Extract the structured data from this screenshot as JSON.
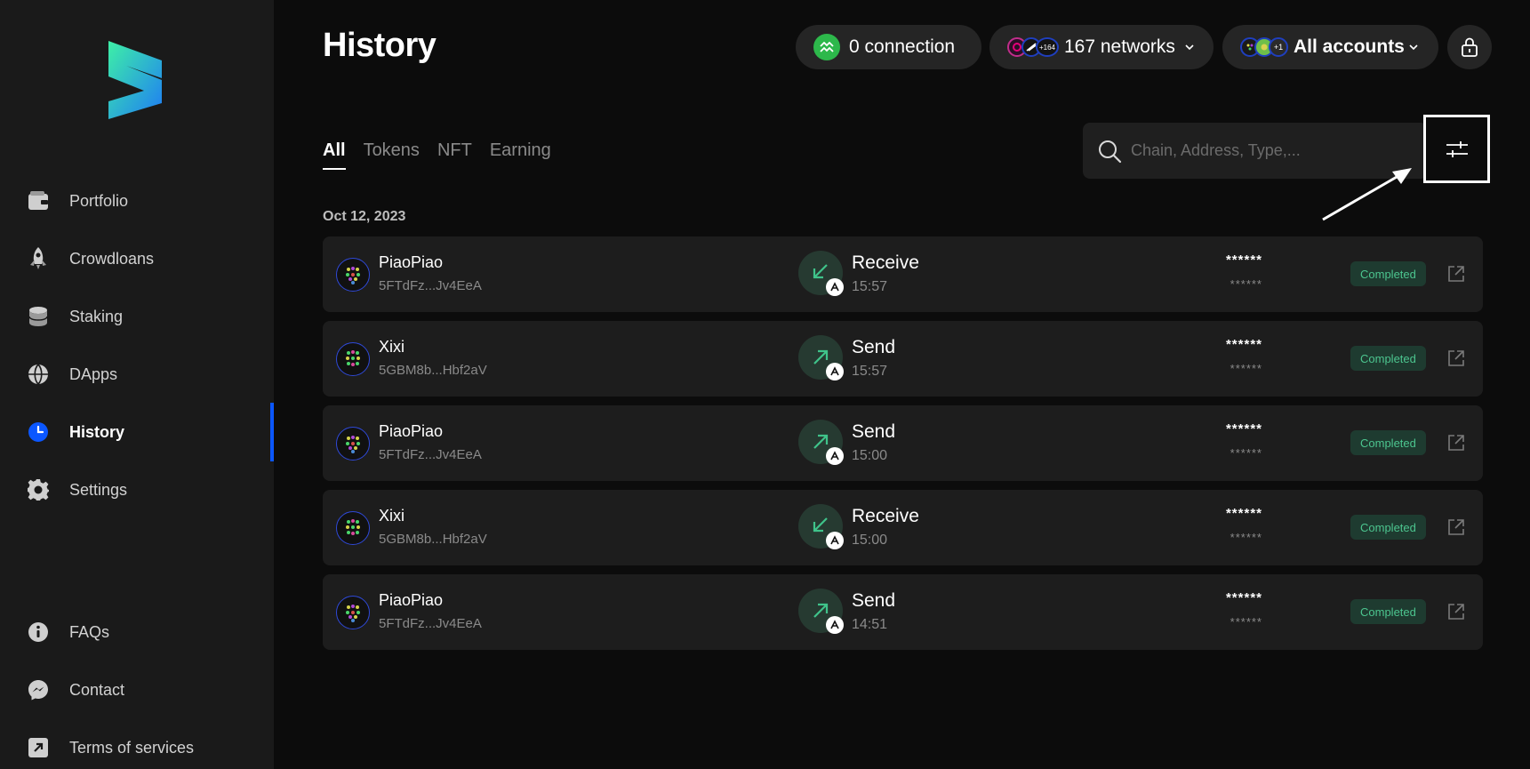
{
  "sidebar": {
    "nav": [
      {
        "key": "portfolio",
        "label": "Portfolio",
        "icon": "wallet-icon"
      },
      {
        "key": "crowdloans",
        "label": "Crowdloans",
        "icon": "rocket-icon"
      },
      {
        "key": "staking",
        "label": "Staking",
        "icon": "coins-stack-icon"
      },
      {
        "key": "dapps",
        "label": "DApps",
        "icon": "globe-icon"
      },
      {
        "key": "history",
        "label": "History",
        "icon": "clock-icon",
        "active": true
      },
      {
        "key": "settings",
        "label": "Settings",
        "icon": "gear-icon"
      }
    ],
    "bottom": [
      {
        "key": "faqs",
        "label": "FAQs",
        "icon": "info-icon"
      },
      {
        "key": "contact",
        "label": "Contact",
        "icon": "messenger-icon"
      },
      {
        "key": "terms",
        "label": "Terms of services",
        "icon": "external-square-icon"
      }
    ]
  },
  "header": {
    "title": "History",
    "connection_label": "0 connection",
    "networks_badge": "+164",
    "networks_label": "167 networks",
    "accounts_badge": "+1",
    "accounts_label": "All accounts"
  },
  "tabs": [
    "All",
    "Tokens",
    "NFT",
    "Earning"
  ],
  "search": {
    "placeholder": "Chain, Address, Type,..."
  },
  "date_group": "Oct 12, 2023",
  "transactions": [
    {
      "account": "PiaoPiao",
      "address": "5FTdFz...Jv4EeA",
      "type": "Receive",
      "time": "15:57",
      "amount": "******",
      "amount_sub": "******",
      "status": "Completed"
    },
    {
      "account": "Xixi",
      "address": "5GBM8b...Hbf2aV",
      "type": "Send",
      "time": "15:57",
      "amount": "******",
      "amount_sub": "******",
      "status": "Completed"
    },
    {
      "account": "PiaoPiao",
      "address": "5FTdFz...Jv4EeA",
      "type": "Send",
      "time": "15:00",
      "amount": "******",
      "amount_sub": "******",
      "status": "Completed"
    },
    {
      "account": "Xixi",
      "address": "5GBM8b...Hbf2aV",
      "type": "Receive",
      "time": "15:00",
      "amount": "******",
      "amount_sub": "******",
      "status": "Completed"
    },
    {
      "account": "PiaoPiao",
      "address": "5FTdFz...Jv4EeA",
      "type": "Send",
      "time": "14:51",
      "amount": "******",
      "amount_sub": "******",
      "status": "Completed"
    }
  ],
  "colors": {
    "accent": "#0b57ff",
    "success": "#4cc58f",
    "connection_green": "#2db84b"
  }
}
